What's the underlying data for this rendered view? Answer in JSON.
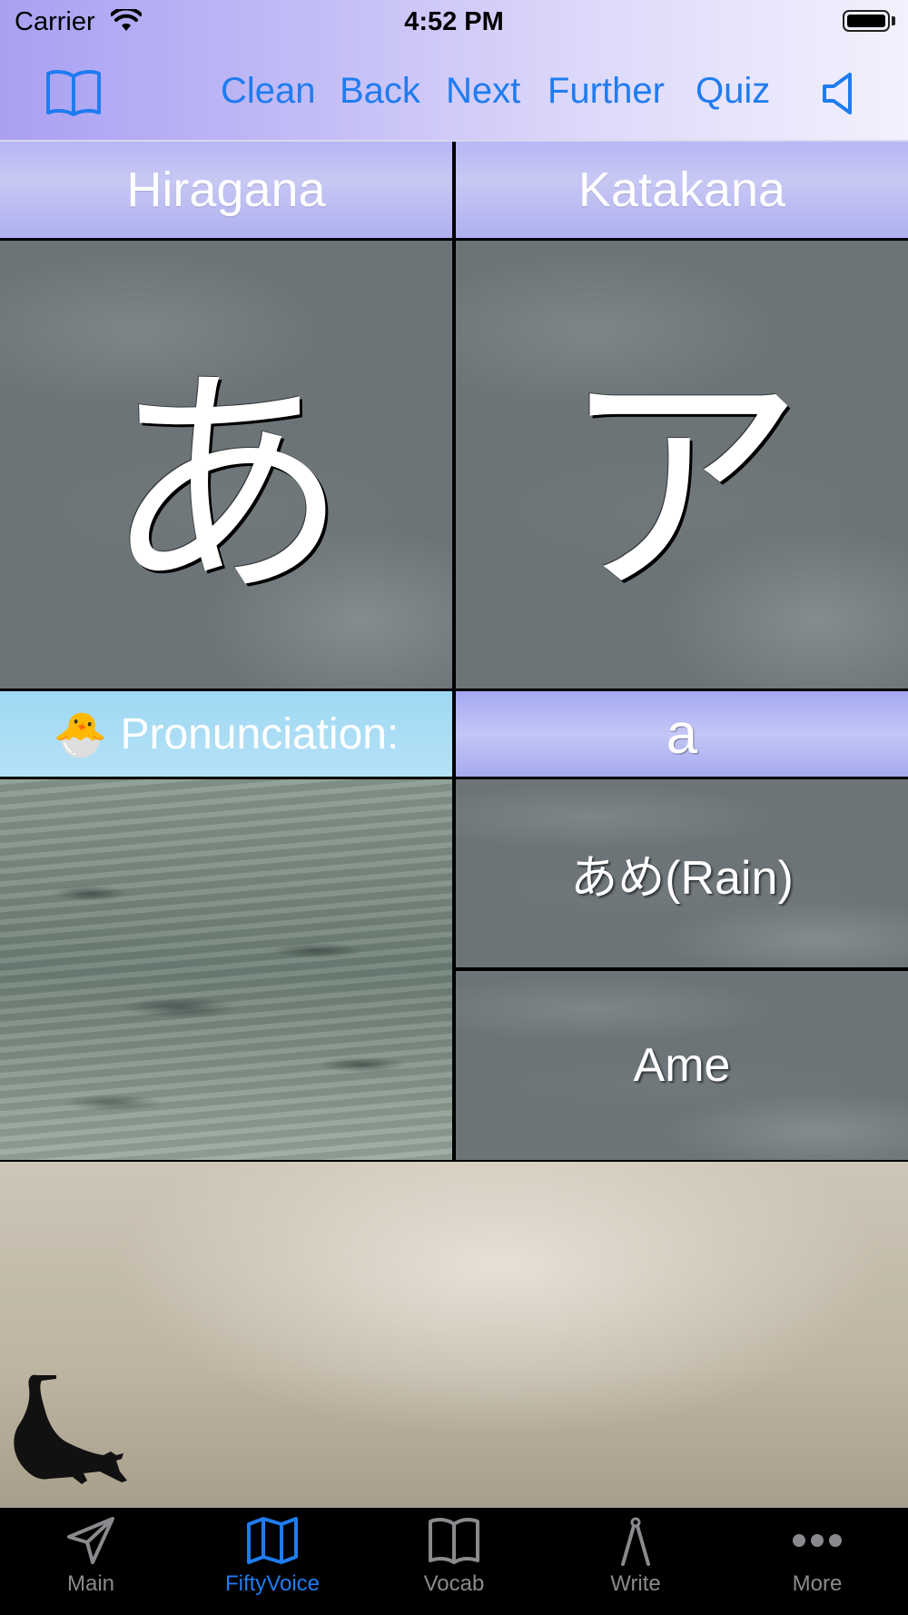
{
  "status_bar": {
    "carrier": "Carrier",
    "time": "4:52 PM"
  },
  "nav": {
    "left_icon": "book-icon",
    "buttons": [
      "Clean",
      "Back",
      "Next",
      "Further",
      "Quiz"
    ],
    "right_icon": "speaker-icon",
    "accent_color": "#1f7cf0"
  },
  "grid": {
    "hiragana_label": "Hiragana",
    "katakana_label": "Katakana",
    "hiragana_char": "あ",
    "katakana_char": "ア",
    "pronunciation_icon": "🐣",
    "pronunciation_label": "Pronunciation:",
    "pronunciation_value": "a",
    "word_kana": "あめ(Rain)",
    "word_romaji": "Ame"
  },
  "tabs": [
    {
      "label": "Main",
      "icon": "paper-plane-icon",
      "active": false
    },
    {
      "label": "FiftyVoice",
      "icon": "map-icon",
      "active": true
    },
    {
      "label": "Vocab",
      "icon": "book-icon",
      "active": false
    },
    {
      "label": "Write",
      "icon": "compass-icon",
      "active": false
    },
    {
      "label": "More",
      "icon": "more-dots-icon",
      "active": false
    }
  ]
}
